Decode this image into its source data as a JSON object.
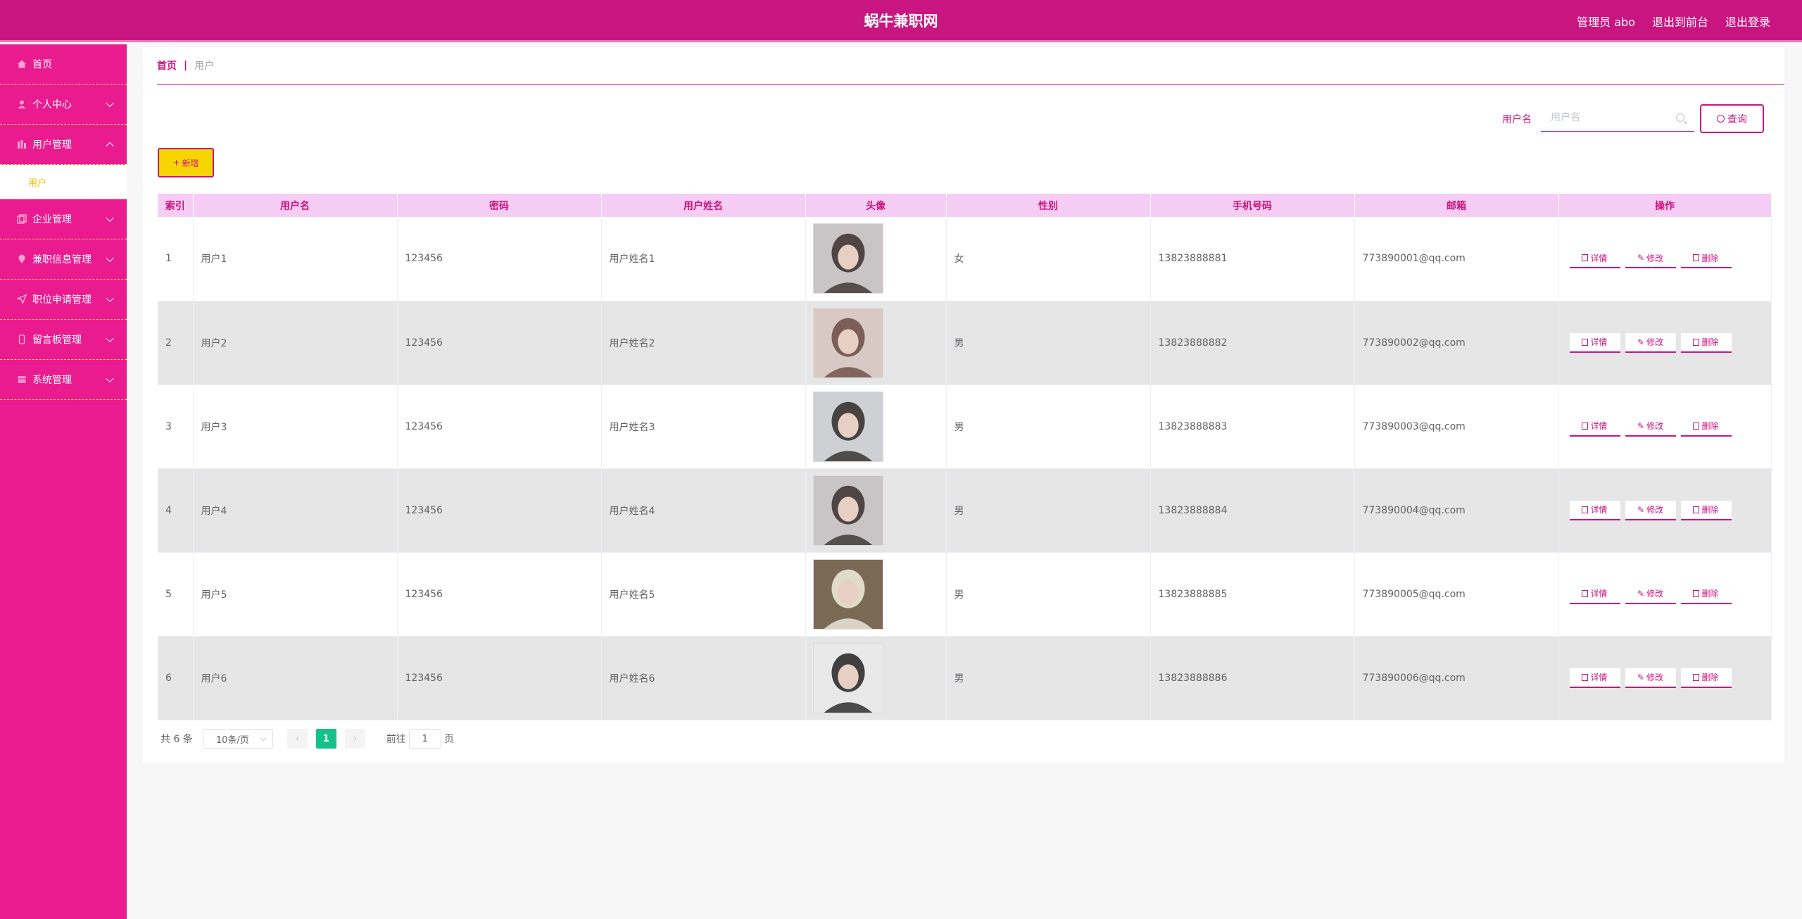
{
  "header": {
    "title": "蜗牛兼职网",
    "admin_label": "管理员 abo",
    "back_front": "退出到前台",
    "logout": "退出登录"
  },
  "sidebar": {
    "items": [
      {
        "label": "首页",
        "icon": "home-icon"
      },
      {
        "label": "个人中心",
        "icon": "user-icon"
      },
      {
        "label": "用户管理",
        "icon": "chart-icon"
      },
      {
        "label": "企业管理",
        "icon": "copy-icon"
      },
      {
        "label": "兼职信息管理",
        "icon": "location-icon"
      },
      {
        "label": "职位申请管理",
        "icon": "send-icon"
      },
      {
        "label": "留言板管理",
        "icon": "phone-icon"
      },
      {
        "label": "系统管理",
        "icon": "box-icon"
      }
    ],
    "submenu_active": "用户"
  },
  "breadcrumb": {
    "home": "首页",
    "sep": "|",
    "current": "用户"
  },
  "search": {
    "label": "用户名",
    "placeholder": "用户名",
    "button": "查询"
  },
  "add_button": "新增",
  "table": {
    "headers": [
      "索引",
      "用户名",
      "密码",
      "用户姓名",
      "头像",
      "性别",
      "手机号码",
      "邮箱",
      "操作"
    ],
    "rows": [
      {
        "index": "1",
        "username": "用户1",
        "password": "123456",
        "name": "用户姓名1",
        "gender": "女",
        "phone": "13823888881",
        "email": "773890001@qq.com"
      },
      {
        "index": "2",
        "username": "用户2",
        "password": "123456",
        "name": "用户姓名2",
        "gender": "男",
        "phone": "13823888882",
        "email": "773890002@qq.com"
      },
      {
        "index": "3",
        "username": "用户3",
        "password": "123456",
        "name": "用户姓名3",
        "gender": "男",
        "phone": "13823888883",
        "email": "773890003@qq.com"
      },
      {
        "index": "4",
        "username": "用户4",
        "password": "123456",
        "name": "用户姓名4",
        "gender": "男",
        "phone": "13823888884",
        "email": "773890004@qq.com"
      },
      {
        "index": "5",
        "username": "用户5",
        "password": "123456",
        "name": "用户姓名5",
        "gender": "男",
        "phone": "13823888885",
        "email": "773890005@qq.com"
      },
      {
        "index": "6",
        "username": "用户6",
        "password": "123456",
        "name": "用户姓名6",
        "gender": "男",
        "phone": "13823888886",
        "email": "773890006@qq.com"
      }
    ],
    "actions": {
      "detail": "详情",
      "edit": "修改",
      "delete": "删除"
    }
  },
  "pagination": {
    "total_text": "共 6 条",
    "page_size": "10条/页",
    "current_page": "1",
    "goto_label": "前往",
    "goto_value": "1",
    "page_unit": "页"
  },
  "colors": {
    "primary": "#c8157f",
    "sidebar": "#ea1b8f",
    "accent_yellow": "#f8d500",
    "page_active": "#13c28a",
    "table_header": "#f5ccf4"
  }
}
